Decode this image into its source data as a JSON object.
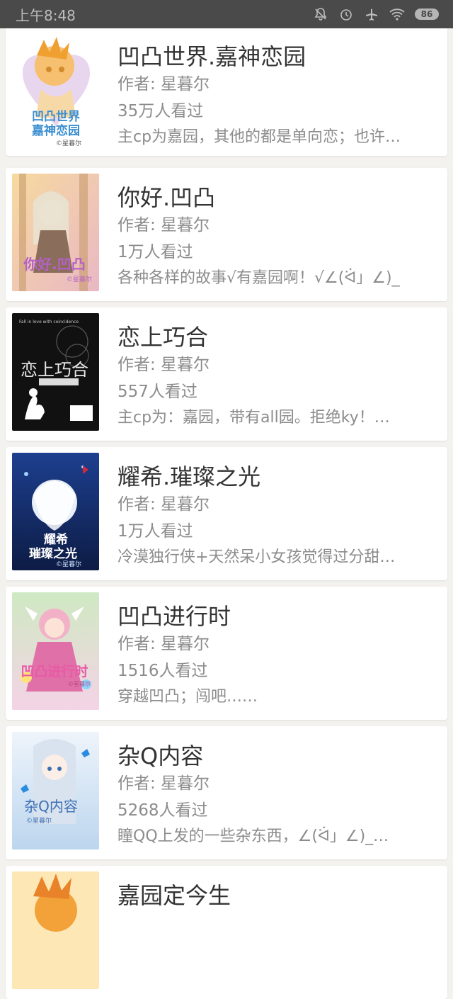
{
  "status_bar": {
    "time": "上午8:48",
    "battery": "86",
    "icons": [
      "bell-off-icon",
      "alarm-icon",
      "airplane-icon",
      "wifi-icon",
      "battery-icon"
    ]
  },
  "books": [
    {
      "title": "凹凸世界.嘉神恋园",
      "author": "作者: 星暮尔",
      "views": "35万人看过",
      "desc": "主cp为嘉园，其他的都是单向恋；也许…",
      "cover_text": "凹凸世界 嘉神恋园",
      "cover_sub": "©星暮尔"
    },
    {
      "title": "你好.凹凸",
      "author": "作者: 星暮尔",
      "views": "1万人看过",
      "desc": "各种各样的故事√有嘉园啊！√∠(ᐛ」∠)_",
      "cover_text": "你好.凹凸",
      "cover_sub": "©星暮尔"
    },
    {
      "title": "恋上巧合",
      "author": "作者: 星暮尔",
      "views": "557人看过",
      "desc": "主cp为：嘉园，带有all园。拒绝ky！…",
      "cover_text": "恋上巧合",
      "cover_sub": "Fall in love with coincidence"
    },
    {
      "title": "耀希.璀璨之光",
      "author": "作者: 星暮尔",
      "views": "1万人看过",
      "desc": "冷漠独行侠+天然呆小女孩觉得过分甜…",
      "cover_text": "耀希 璀璨之光",
      "cover_sub": "©星暮尔"
    },
    {
      "title": "凹凸进行时",
      "author": "作者: 星暮尔",
      "views": "1516人看过",
      "desc": "穿越凹凸；闯吧……",
      "cover_text": "凹凸进行时",
      "cover_sub": "©星暮尔"
    },
    {
      "title": "杂Q内容",
      "author": "作者: 星暮尔",
      "views": "5268人看过",
      "desc": "瞳QQ上发的一些杂东西，∠(ᐛ」∠)_…",
      "cover_text": "杂Q内容",
      "cover_sub": "©星暮尔"
    },
    {
      "title": "嘉园定今生",
      "author": "",
      "views": "",
      "desc": "",
      "cover_text": "",
      "cover_sub": ""
    }
  ],
  "colors": {
    "background": "#f3f2ee",
    "card": "#ffffff",
    "title": "#333333",
    "meta": "#8c8c8c",
    "status_bar": "#4a4a4a"
  }
}
